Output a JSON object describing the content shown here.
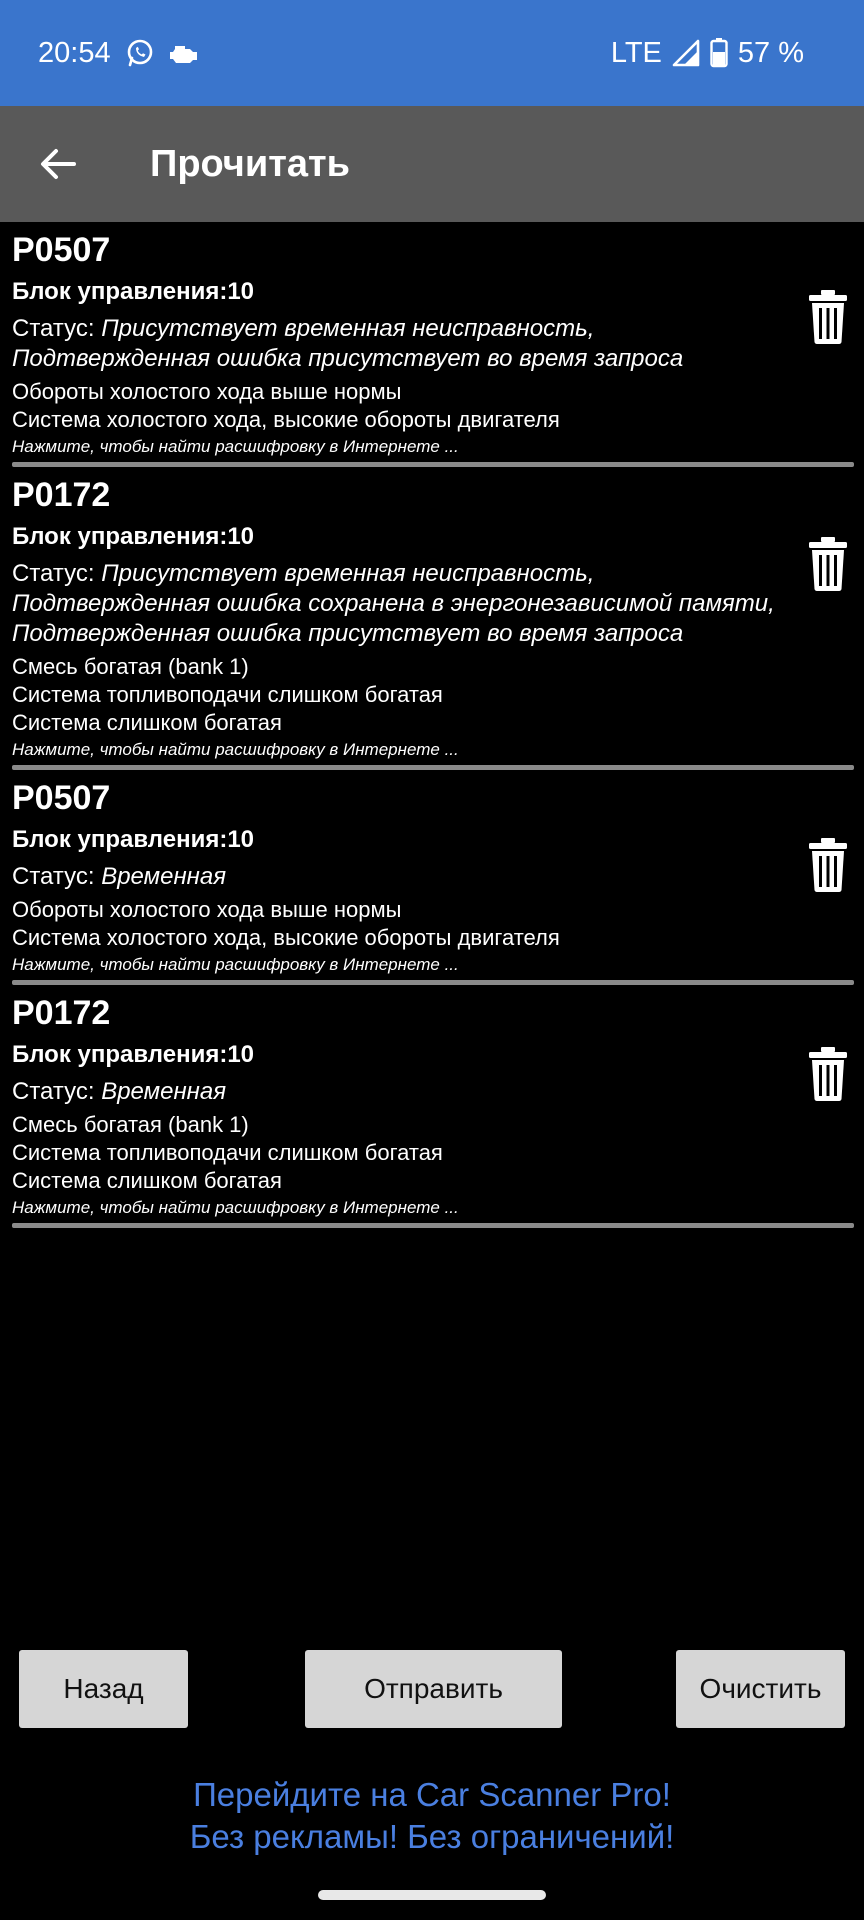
{
  "status_bar": {
    "time": "20:54",
    "network": "LTE",
    "battery": "57 %",
    "icons": [
      "whatsapp-icon",
      "engine-icon",
      "signal-icon",
      "battery-icon"
    ]
  },
  "app_bar": {
    "title": "Прочитать",
    "back_icon": "arrow-left-icon"
  },
  "errors": [
    {
      "code": "P0507",
      "ecu": "Блок управления:10",
      "status_label": "Статус: ",
      "status_value": "Присутствует временная неисправность, Подтвержденная ошибка присутствует во время запроса",
      "descriptions": [
        "Обороты холостого хода выше нормы",
        "Система холостого хода, высокие обороты двигателя"
      ],
      "hint": "Нажмите, чтобы найти расшифровку в Интернете ..."
    },
    {
      "code": "P0172",
      "ecu": "Блок управления:10",
      "status_label": "Статус: ",
      "status_value": "Присутствует временная неисправность, Подтвержденная ошибка сохранена в энергонезависимой памяти, Подтвержденная ошибка присутствует во время запроса",
      "descriptions": [
        "Смесь богатая (bank 1)",
        "Система топливоподачи слишком богатая",
        "Система слишком богатая"
      ],
      "hint": "Нажмите, чтобы найти расшифровку в Интернете ..."
    },
    {
      "code": "P0507",
      "ecu": "Блок управления:10",
      "status_label": "Статус: ",
      "status_value": "Временная",
      "descriptions": [
        "Обороты холостого хода выше нормы",
        "Система холостого хода, высокие обороты двигателя"
      ],
      "hint": "Нажмите, чтобы найти расшифровку в Интернете ..."
    },
    {
      "code": "P0172",
      "ecu": "Блок управления:10",
      "status_label": "Статус: ",
      "status_value": "Временная",
      "descriptions": [
        "Смесь богатая (bank 1)",
        "Система топливоподачи слишком богатая",
        "Система слишком богатая"
      ],
      "hint": "Нажмите, чтобы найти расшифровку в Интернете ..."
    }
  ],
  "buttons": {
    "back": "Назад",
    "send": "Отправить",
    "clear": "Очистить"
  },
  "promo": {
    "line1": "Перейдите на Car Scanner Pro!",
    "line2": "Без рекламы! Без ограничений!"
  },
  "colors": {
    "status_bar": "#3a75cc",
    "app_bar": "#595959",
    "background": "#000000",
    "button": "#d6d6d6",
    "promo_text": "#4a7fe0"
  }
}
